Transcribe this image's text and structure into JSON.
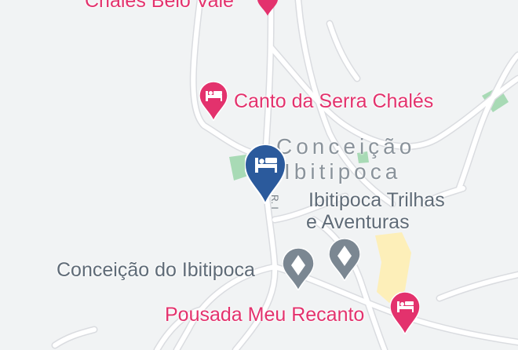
{
  "map": {
    "background": "#f1f3f4",
    "road_color": "#ffffff",
    "road_casing": "#dadce0",
    "park_color": "#a8dab5",
    "path_color": "#fdefb9"
  },
  "labels": {
    "top_clipped": "Chalés Belo Vale",
    "canto": "Canto da Serra Chalés",
    "town_line1": "Conceição",
    "town_line2": "Ibitipoca",
    "trilhas_line1": "Ibitipoca Trilhas",
    "trilhas_line2": "e Aventuras",
    "conceicao_poi": "Conceição do Ibitipoca",
    "pousada": "Pousada Meu Recanto",
    "road_ref": "R. I"
  },
  "markers": {
    "hotel_icon": "bed-icon",
    "hotel_color": "#e3326d",
    "gray_icon": "place-icon",
    "gray_color": "#7b8792",
    "selected_icon": "bed-icon",
    "selected_color": "#2b5a9c"
  }
}
